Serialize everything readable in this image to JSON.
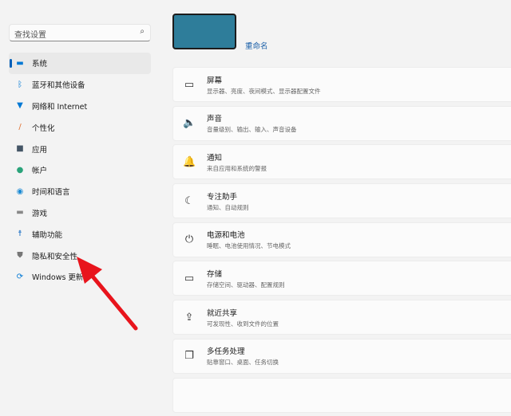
{
  "search": {
    "placeholder": "查找设置",
    "icon": "search-icon"
  },
  "nav": [
    {
      "label": "系统",
      "icon": "monitor-icon",
      "color": "#0078d4"
    },
    {
      "label": "蓝牙和其他设备",
      "icon": "bluetooth-icon",
      "color": "#0078d4"
    },
    {
      "label": "网络和 Internet",
      "icon": "wifi-icon",
      "color": "#0078d4"
    },
    {
      "label": "个性化",
      "icon": "brush-icon",
      "color": "#e07030"
    },
    {
      "label": "应用",
      "icon": "apps-icon",
      "color": "#445566"
    },
    {
      "label": "帐户",
      "icon": "person-icon",
      "color": "#2aa37a"
    },
    {
      "label": "时间和语言",
      "icon": "globe-icon",
      "color": "#1a8ad4"
    },
    {
      "label": "游戏",
      "icon": "gamepad-icon",
      "color": "#888888"
    },
    {
      "label": "辅助功能",
      "icon": "accessibility-icon",
      "color": "#1a6fc4"
    },
    {
      "label": "隐私和安全性",
      "icon": "shield-icon",
      "color": "#777777"
    },
    {
      "label": "Windows 更新",
      "icon": "update-icon",
      "color": "#0078d4"
    }
  ],
  "device": {
    "rename": "重命名"
  },
  "cards": [
    {
      "title": "屏幕",
      "sub": "显示器、亮度、夜间模式、显示器配置文件",
      "icon": "laptop-icon",
      "glyph": "▭"
    },
    {
      "title": "声音",
      "sub": "音量级别、输出、输入、声音设备",
      "icon": "speaker-icon",
      "glyph": "🔈"
    },
    {
      "title": "通知",
      "sub": "来自应用和系统的警报",
      "icon": "bell-icon",
      "glyph": "🔔"
    },
    {
      "title": "专注助手",
      "sub": "通知、自动规则",
      "icon": "moon-icon",
      "glyph": "☾"
    },
    {
      "title": "电源和电池",
      "sub": "睡眠、电池使用情况、节电模式",
      "icon": "power-icon",
      "glyph": "⏻"
    },
    {
      "title": "存储",
      "sub": "存储空间、驱动器、配置规则",
      "icon": "storage-icon",
      "glyph": "▭"
    },
    {
      "title": "就近共享",
      "sub": "可发现性、收到文件的位置",
      "icon": "share-icon",
      "glyph": "⇪"
    },
    {
      "title": "多任务处理",
      "sub": "贴靠窗口、桌面、任务切换",
      "icon": "multitask-icon",
      "glyph": "❐"
    }
  ]
}
